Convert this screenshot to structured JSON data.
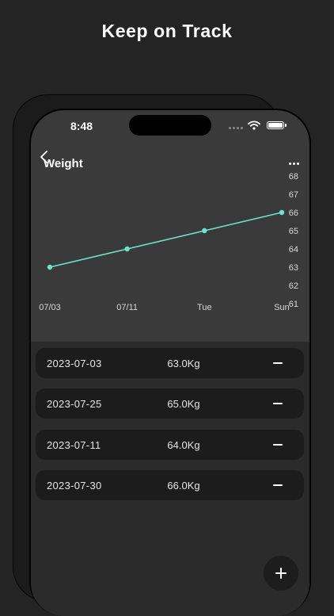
{
  "promo": {
    "headline": "Keep on Track"
  },
  "status_bar": {
    "time": "8:48"
  },
  "header": {
    "title": "Weight",
    "back_icon": "chevron-left-icon",
    "more_icon": "ellipsis-icon"
  },
  "chart_data": {
    "type": "line",
    "categories": [
      "07/03",
      "07/11",
      "Tue",
      "Sun"
    ],
    "values": [
      63.0,
      64.0,
      65.0,
      66.0
    ],
    "y_ticks": [
      "68",
      "67",
      "66",
      "65",
      "64",
      "63",
      "62",
      "61"
    ],
    "ylim": [
      61,
      68
    ],
    "y_axis_position": "right",
    "grid": false,
    "line_color": "#6fe3c8"
  },
  "records": [
    {
      "date": "2023-07-03",
      "weight": "63.0Kg"
    },
    {
      "date": "2023-07-25",
      "weight": "65.0Kg"
    },
    {
      "date": "2023-07-11",
      "weight": "64.0Kg"
    },
    {
      "date": "2023-07-30",
      "weight": "66.0Kg"
    }
  ],
  "colors": {
    "accent": "#6fe3c8",
    "background": "#242424",
    "card": "#1c1c1c"
  }
}
